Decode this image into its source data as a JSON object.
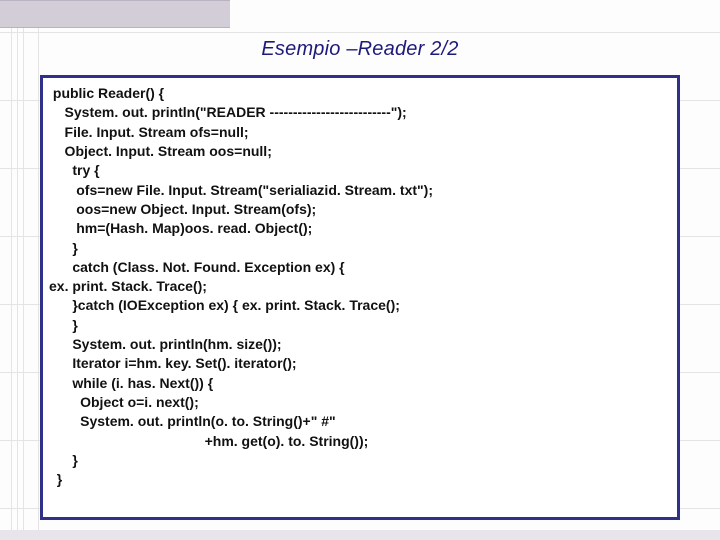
{
  "slide": {
    "title": "Esempio –Reader 2/2"
  },
  "code": {
    "l01": " public Reader() {",
    "l02": "    System. out. println(\"READER --------------------------\");",
    "l03": "    File. Input. Stream ofs=null;",
    "l04": "    Object. Input. Stream oos=null;",
    "l05": "      try {",
    "l06": "       ofs=new File. Input. Stream(\"serialiazid. Stream. txt\");",
    "l07": "       oos=new Object. Input. Stream(ofs);",
    "l08": "       hm=(Hash. Map)oos. read. Object();",
    "l09": "      }",
    "l10": "      catch (Class. Not. Found. Exception ex) {",
    "l11": "ex. print. Stack. Trace();",
    "l12": "      }catch (IOException ex) { ex. print. Stack. Trace();",
    "l13": "      }",
    "l14": "      System. out. println(hm. size());",
    "l15": "      Iterator i=hm. key. Set(). iterator();",
    "l16": "      while (i. has. Next()) {",
    "l17": "        Object o=i. next();",
    "l18": "        System. out. println(o. to. String()+\" #\"",
    "l19": "                                        +hm. get(o). to. String());",
    "l20": "      }",
    "l21": "  }"
  }
}
